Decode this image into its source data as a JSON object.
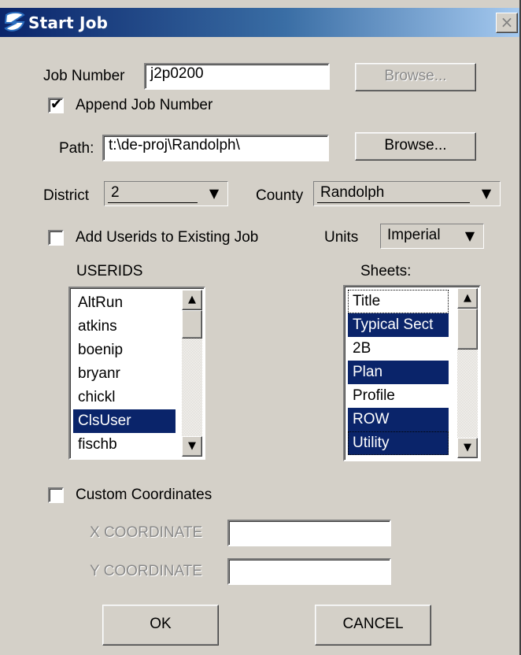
{
  "window": {
    "title": "Start Job",
    "close_label": "×"
  },
  "job": {
    "number_label": "Job Number",
    "number_value": "j2p0200",
    "browse_label": "Browse...",
    "append_label": "Append Job Number",
    "append_checked": true
  },
  "path": {
    "label": "Path:",
    "value": "t:\\de-proj\\Randolph\\",
    "browse_label": "Browse..."
  },
  "district": {
    "label": "District",
    "value": "2"
  },
  "county": {
    "label": "County",
    "value": "Randolph"
  },
  "add_userids": {
    "label": "Add Userids to Existing Job",
    "checked": false
  },
  "units": {
    "label": "Units",
    "value": "Imperial"
  },
  "userids": {
    "header": "USERIDS",
    "items": [
      {
        "label": "AltRun",
        "selected": false
      },
      {
        "label": "atkins",
        "selected": false
      },
      {
        "label": "boenip",
        "selected": false
      },
      {
        "label": "bryanr",
        "selected": false
      },
      {
        "label": "chickl",
        "selected": false
      },
      {
        "label": "ClsUser",
        "selected": true
      },
      {
        "label": "fischb",
        "selected": false
      }
    ]
  },
  "sheets": {
    "header": "Sheets:",
    "items": [
      {
        "label": "Title",
        "selected": false
      },
      {
        "label": "Typical Sect",
        "selected": true
      },
      {
        "label": "2B",
        "selected": false
      },
      {
        "label": "Plan",
        "selected": true
      },
      {
        "label": "Profile",
        "selected": false
      },
      {
        "label": "ROW",
        "selected": true
      },
      {
        "label": "Utility",
        "selected": true
      }
    ]
  },
  "custom_coords": {
    "label": "Custom Coordinates",
    "checked": false,
    "x_label": "X COORDINATE",
    "x_value": "",
    "y_label": "Y COORDINATE",
    "y_value": ""
  },
  "buttons": {
    "ok_label": "OK",
    "cancel_label": "CANCEL"
  },
  "icons": {
    "dropdown": "▼",
    "scroll_up": "▲",
    "scroll_down": "▼",
    "check": "✔"
  },
  "colors": {
    "selection": "#0a246a",
    "title_start": "#0a246a",
    "title_end": "#a6caf0",
    "face": "#d4d0c8"
  }
}
